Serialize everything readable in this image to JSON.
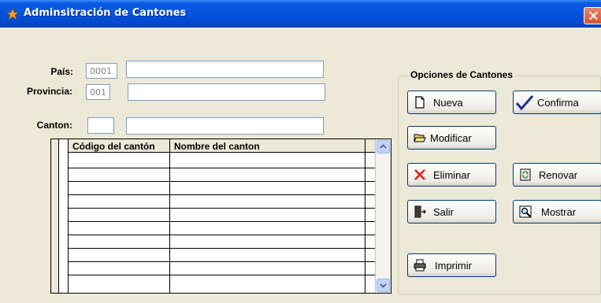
{
  "window": {
    "title": "Adminsitración de Cantones"
  },
  "form": {
    "pais": {
      "label": "País:",
      "code": "0001",
      "name": ""
    },
    "provincia": {
      "label": "Provincia:",
      "code": "001",
      "name": ""
    },
    "canton": {
      "label": "Canton:",
      "code": "",
      "name": ""
    }
  },
  "grid": {
    "columns": [
      "Código del cantón",
      "Nombre del canton"
    ],
    "rows": [
      [
        "",
        ""
      ],
      [
        "",
        ""
      ],
      [
        "",
        ""
      ],
      [
        "",
        ""
      ],
      [
        "",
        ""
      ],
      [
        "",
        ""
      ],
      [
        "",
        ""
      ],
      [
        "",
        ""
      ],
      [
        "",
        ""
      ]
    ]
  },
  "options": {
    "title": "Opciones de Cantones",
    "buttons": {
      "nueva": "Nueva",
      "confirma": "Confirma",
      "modificar": "Modificar",
      "eliminar": "Eliminar",
      "renovar": "Renovar",
      "salir": "Salir",
      "mostrar": "Mostrar",
      "imprimir": "Imprimir"
    }
  },
  "icons": {
    "app": "star-icon",
    "close": "close-icon",
    "scroll_up": "arrow-up-icon",
    "scroll_down": "arrow-down-icon",
    "nueva": "new-document-icon",
    "confirma": "checkmark-icon",
    "modificar": "open-folder-icon",
    "eliminar": "red-x-icon",
    "renovar": "refresh-icon",
    "salir": "exit-door-icon",
    "mostrar": "magnifier-icon",
    "imprimir": "printer-icon"
  },
  "colors": {
    "titlebar": "#0453dd",
    "background": "#ece9d8",
    "delete_icon": "#e02020",
    "check_icon": "#1c2f8a"
  }
}
